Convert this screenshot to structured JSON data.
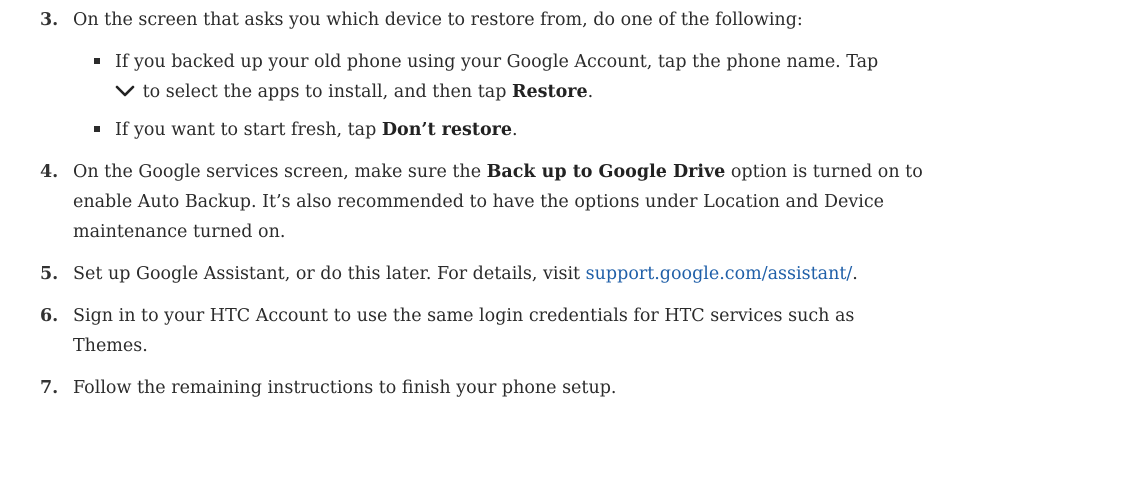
{
  "steps": [
    {
      "num": "3.",
      "text": "On the screen that asks you which device to restore from, do one of the following:",
      "subitems": [
        {
          "line1": "If you backed up your old phone using your Google Account, tap the phone name. Tap",
          "line2_pre": "to select the apps to install, and then tap ",
          "line2_bold": "Restore",
          "line2_post": ".",
          "icon": "chevron-down-icon"
        },
        {
          "pre": "If you want to start fresh, tap ",
          "bold": "Don’t restore",
          "post": "."
        }
      ]
    },
    {
      "num": "4.",
      "line1_pre": "On the Google services screen, make sure the ",
      "line1_bold": "Back up to Google Drive",
      "line1_post": " option is turned on to",
      "line2": "enable Auto Backup. It’s also recommended to have the options under Location and Device",
      "line3": "maintenance turned on."
    },
    {
      "num": "5.",
      "pre": "Set up Google Assistant, or do this later. For details, visit ",
      "link": "support.google.com/assistant/",
      "post": "."
    },
    {
      "num": "6.",
      "line1": "Sign in to your HTC Account to use the same login credentials for HTC services such as",
      "line2": "Themes."
    },
    {
      "num": "7.",
      "text": "Follow the remaining instructions to finish your phone setup."
    }
  ],
  "colors": {
    "text": "#2b2b2b",
    "link": "#1f5fa8"
  }
}
